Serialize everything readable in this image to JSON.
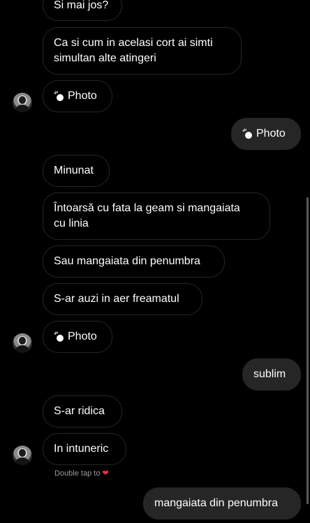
{
  "messages": {
    "m1": "Si mai jos?",
    "m2_line1": "Ca si cum in acelasi cort ai simti",
    "m2_line2": "simultan alte atingeri",
    "photo1": "Photo",
    "photo_out": "Photo",
    "m3": "Minunat",
    "m4_line1": "Întoarsă cu fata la geam si mangaiata",
    "m4_line2": "cu linia",
    "m5": "Sau mangaiata din penumbra",
    "m6": "S-ar auzi in aer freamatul",
    "photo2": "Photo",
    "out_sublim": "sublim",
    "m7": "S-ar ridica",
    "m8": "In intuneric",
    "double_tap_hint": "Double tap to",
    "out_last": "mangaiata din penumbra"
  },
  "colors": {
    "background": "#000000",
    "outgoing_bubble": "#262626",
    "incoming_border": "#262626",
    "hint_text": "#9a9a9a",
    "heart": "#ff3040"
  },
  "icons": {
    "photo": "photo-sparkle-icon",
    "heart": "heart-icon",
    "avatar": "contact-avatar"
  }
}
